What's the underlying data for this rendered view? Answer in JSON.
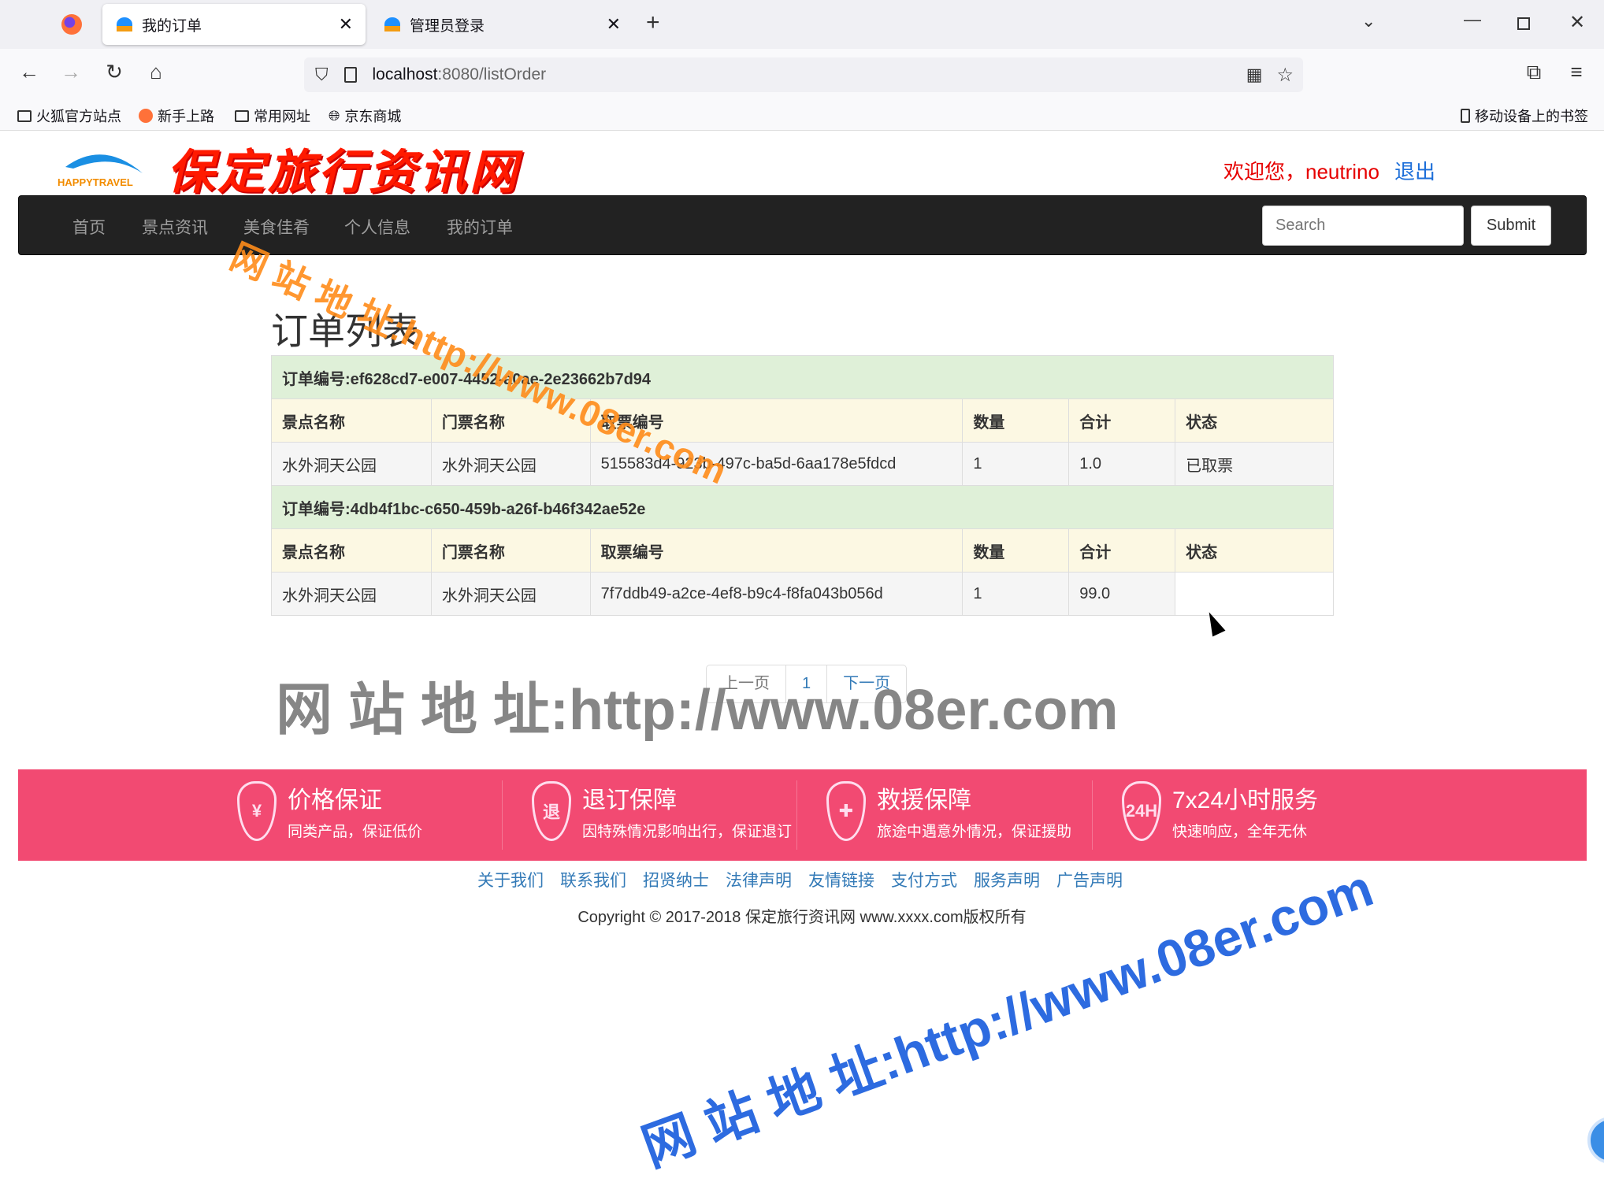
{
  "browser": {
    "tabs": [
      {
        "label": "我的订单",
        "active": true
      },
      {
        "label": "管理员登录",
        "active": false
      }
    ],
    "url_host": "localhost",
    "url_path": ":8080/listOrder",
    "bookmarks": [
      "火狐官方站点",
      "新手上路",
      "常用网址",
      "京东商城"
    ],
    "mobile_bookmarks": "移动设备上的书签"
  },
  "header": {
    "logo_text": "HAPPYTRAVEL",
    "site_title": "保定旅行资讯网",
    "welcome": "欢迎您，neutrino",
    "logout": "退出"
  },
  "nav": {
    "items": [
      "首页",
      "景点资讯",
      "美食佳肴",
      "个人信息",
      "我的订单"
    ],
    "search_placeholder": "Search",
    "submit": "Submit"
  },
  "main": {
    "title": "订单列表",
    "columns": [
      "景点名称",
      "门票名称",
      "取票编号",
      "数量",
      "合计",
      "状态"
    ],
    "orders": [
      {
        "order_label": "订单编号:ef628cd7-e007-4452-a0ae-2e23662b7d94",
        "row": [
          "水外洞天公园",
          "水外洞天公园",
          "515583d4-923b-497c-ba5d-6aa178e5fdcd",
          "1",
          "1.0",
          "已取票"
        ]
      },
      {
        "order_label": "订单编号:4db4f1bc-c650-459b-a26f-b46f342ae52e",
        "row": [
          "水外洞天公园",
          "水外洞天公园",
          "7f7ddb49-a2ce-4ef8-b9c4-f8fa043b056d",
          "1",
          "99.0",
          ""
        ]
      }
    ],
    "pager": {
      "prev": "上一页",
      "current": "1",
      "next": "下一页"
    }
  },
  "features": [
    {
      "icon": "¥",
      "title": "价格保证",
      "sub": "同类产品，保证低价"
    },
    {
      "icon": "退",
      "title": "退订保障",
      "sub": "因特殊情况影响出行，保证退订"
    },
    {
      "icon": "✚",
      "title": "救援保障",
      "sub": "旅途中遇意外情况，保证援助"
    },
    {
      "icon": "24H",
      "title": "7x24小时服务",
      "sub": "快速响应，全年无休"
    }
  ],
  "footer": {
    "links": [
      "关于我们",
      "联系我们",
      "招贤纳士",
      "法律声明",
      "友情链接",
      "支付方式",
      "服务声明",
      "广告声明"
    ],
    "copyright": "Copyright © 2017-2018 保定旅行资讯网 www.xxxx.com版权所有"
  },
  "watermarks": [
    "网 站 地 址:http://www.08er.com",
    "网 站 地 址:http://www.08er.com",
    "网 站 地 址:http://www.08er.com"
  ],
  "colors": {
    "band": "#f24a72",
    "link": "#337ab7",
    "order_row": "#dff0d8",
    "header_row": "#fcf8e3",
    "navbar": "#222222"
  }
}
